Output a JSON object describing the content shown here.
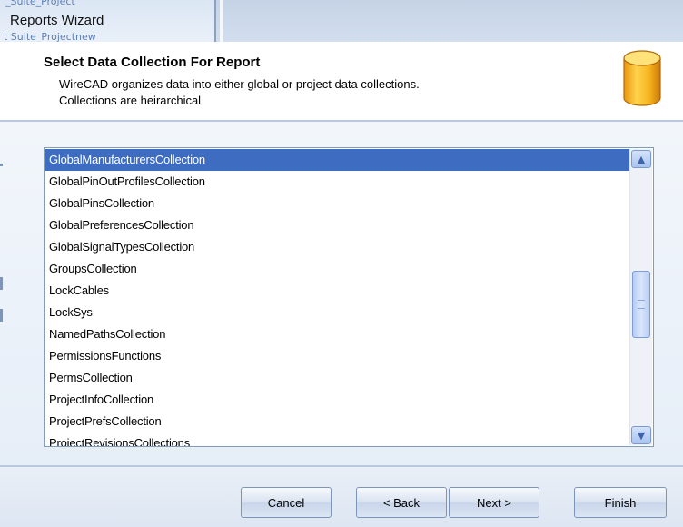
{
  "window": {
    "title": "Reports Wizard",
    "bg_text_top": "_Suite_Project",
    "bg_text_bottom": "t Suite_Projectnew"
  },
  "header": {
    "title": "Select Data Collection For Report",
    "desc_line1": "WireCAD organizes data into either global or project data collections.",
    "desc_line2": "Collections are heirarchical",
    "icon": "database-icon"
  },
  "list": {
    "selected_index": 0,
    "items": [
      "GlobalManufacturersCollection",
      "GlobalPinOutProfilesCollection",
      "GlobalPinsCollection",
      "GlobalPreferencesCollection",
      "GlobalSignalTypesCollection",
      "GroupsCollection",
      "LockCables",
      "LockSys",
      "NamedPathsCollection",
      "PermissionsFunctions",
      "PermsCollection",
      "ProjectInfoCollection",
      "ProjectPrefsCollection",
      "ProjectRevisionsCollections"
    ],
    "scroll_position": 0.5
  },
  "buttons": {
    "cancel": "Cancel",
    "back": "< Back",
    "next": "Next >",
    "finish": "Finish"
  },
  "colors": {
    "selection": "#3d6cc0",
    "accent": "#f5b41e"
  }
}
